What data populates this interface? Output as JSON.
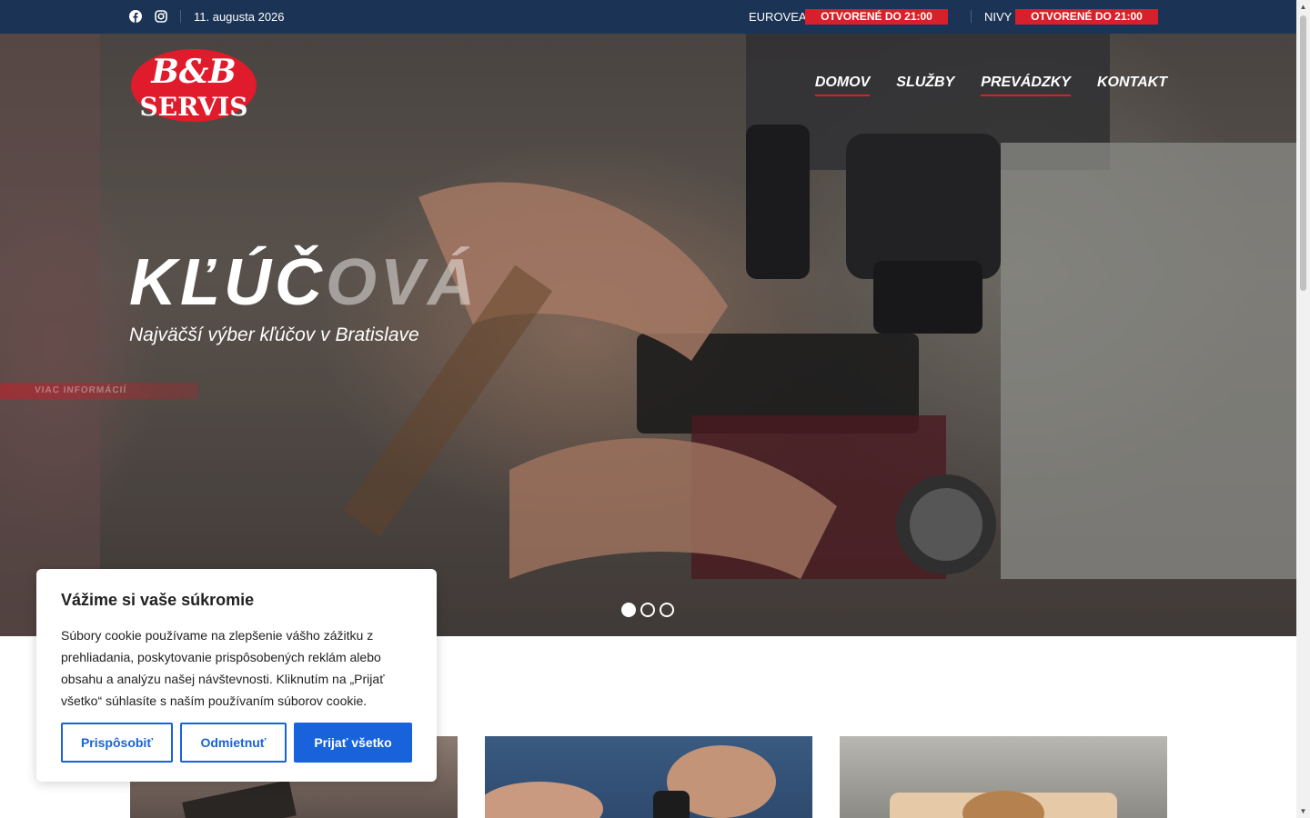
{
  "topbar": {
    "date": "11. augusta 2026",
    "stores": [
      {
        "name": "EUROVEA",
        "status": "OTVORENÉ DO 21:00"
      },
      {
        "name": "NIVY",
        "status": "OTVORENÉ DO 21:00"
      }
    ],
    "social": [
      "facebook-icon",
      "instagram-icon"
    ]
  },
  "logo": {
    "line1": "B&B",
    "line2": "SERVIS"
  },
  "nav": {
    "items": [
      {
        "label": "DOMOV",
        "active": true
      },
      {
        "label": "SLUŽBY",
        "active": false
      },
      {
        "label": "PREVÁDZKY",
        "active": true
      },
      {
        "label": "KONTAKT",
        "active": false
      }
    ]
  },
  "hero": {
    "title_solid": "KĽÚČ",
    "title_fade": "OVÁ",
    "subtitle": "Najväčší výber kľúčov v Bratislave",
    "more": "VIAC INFORMÁCIÍ",
    "slides": 3,
    "active_slide": 1
  },
  "cookie": {
    "title": "Vážime si vaše súkromie",
    "text": "Súbory cookie používame na zlepšenie vášho zážitku z prehliadania, poskytovanie prispôsobených reklám alebo obsahu a analýzu našej návštevnosti. Kliknutím na „Prijať všetko“ súhlasíte s naším používaním súborov cookie.",
    "customize": "Prispôsobiť",
    "reject": "Odmietnuť",
    "accept": "Prijať všetko"
  },
  "colors": {
    "topbar": "#1b3355",
    "accent_red": "#d7202b",
    "cookie_blue": "#1863dc"
  }
}
